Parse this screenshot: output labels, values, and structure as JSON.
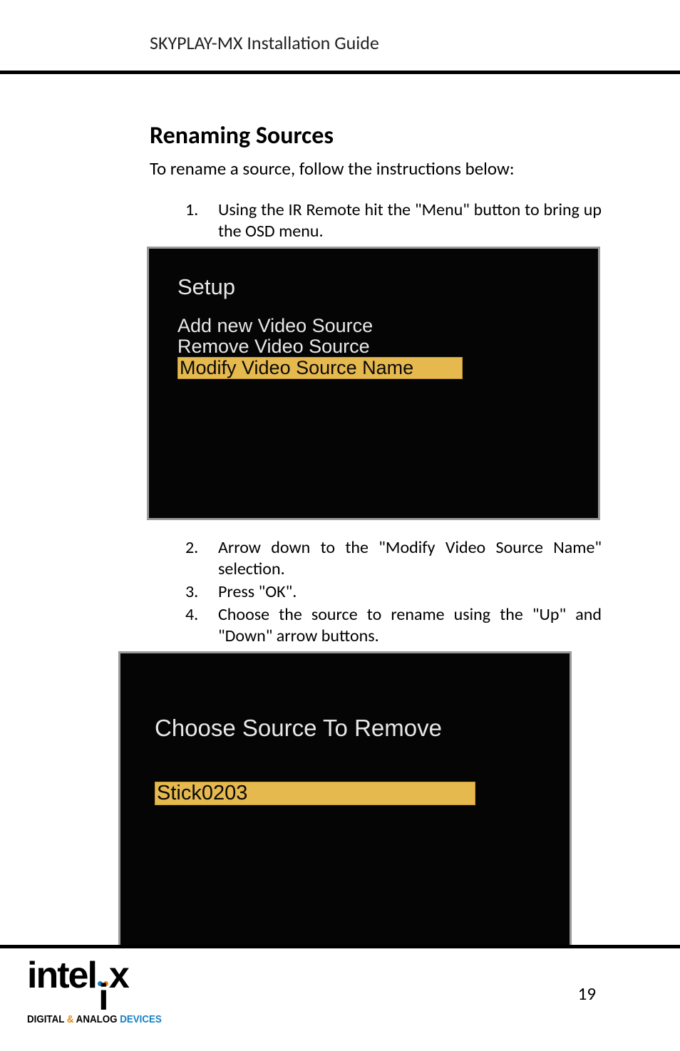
{
  "header": {
    "title": "SKYPLAY-MX Installation Guide"
  },
  "section": {
    "title": "Renaming Sources",
    "intro": "To rename a source, follow the instructions below:"
  },
  "steps": {
    "s1_num": "1.",
    "s1": "Using the IR Remote hit the \"Menu\" button to bring up the OSD menu.",
    "s2_num": "2.",
    "s2": "Arrow down to the \"Modify Video Source Name\" selection.",
    "s3_num": "3.",
    "s3": "Press \"OK\".",
    "s4_num": "4.",
    "s4": "Choose the source to rename using the \"Up\" and \"Down\" arrow buttons."
  },
  "osd1": {
    "title": "Setup",
    "line1": "Add new Video Source",
    "line2": "Remove Video Source",
    "highlight": "Modify Video Source Name"
  },
  "osd2": {
    "title": "Choose Source To Remove",
    "highlight": "Stick0203"
  },
  "footer": {
    "page": "19",
    "logo_main_a": "intel",
    "logo_main_b": "x",
    "logo_i": "i",
    "logo_sub_a": "DIGITAL",
    "logo_sub_amp": " & ",
    "logo_sub_b": "ANALOG ",
    "logo_sub_c": "DEVICES"
  }
}
